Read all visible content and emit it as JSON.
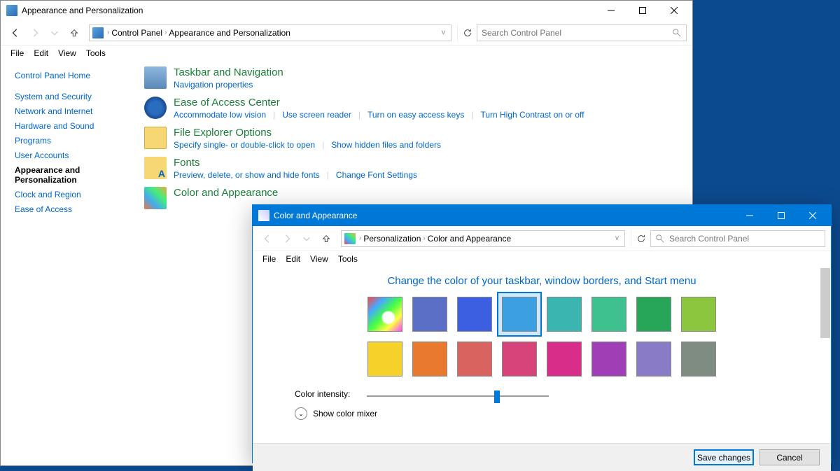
{
  "main_window": {
    "title": "Appearance and Personalization",
    "breadcrumbs": [
      "Control Panel",
      "Appearance and Personalization"
    ],
    "search_placeholder": "Search Control Panel",
    "menus": {
      "file": "File",
      "edit": "Edit",
      "view": "View",
      "tools": "Tools"
    }
  },
  "sidebar": {
    "home": "Control Panel Home",
    "items": [
      "System and Security",
      "Network and Internet",
      "Hardware and Sound",
      "Programs",
      "User Accounts",
      "Appearance and Personalization",
      "Clock and Region",
      "Ease of Access"
    ],
    "active_index": 5
  },
  "categories": [
    {
      "id": "taskbar",
      "title": "Taskbar and Navigation",
      "links": [
        "Navigation properties"
      ]
    },
    {
      "id": "ease",
      "title": "Ease of Access Center",
      "links": [
        "Accommodate low vision",
        "Use screen reader",
        "Turn on easy access keys",
        "Turn High Contrast on or off"
      ]
    },
    {
      "id": "explorer",
      "title": "File Explorer Options",
      "links": [
        "Specify single- or double-click to open",
        "Show hidden files and folders"
      ]
    },
    {
      "id": "fonts",
      "title": "Fonts",
      "links": [
        "Preview, delete, or show and hide fonts",
        "Change Font Settings"
      ]
    },
    {
      "id": "color",
      "title": "Color and Appearance",
      "links": []
    }
  ],
  "dialog": {
    "title": "Color and Appearance",
    "breadcrumbs": [
      "Personalization",
      "Color and Appearance"
    ],
    "search_placeholder": "Search Control Panel",
    "menus": {
      "file": "File",
      "edit": "Edit",
      "view": "View",
      "tools": "Tools"
    },
    "heading": "Change the color of your taskbar, window borders, and Start menu",
    "colors": [
      {
        "hex": "auto",
        "name": "Automatic"
      },
      {
        "hex": "#5b6fc7",
        "name": "Indigo"
      },
      {
        "hex": "#3b5fe0",
        "name": "Blue"
      },
      {
        "hex": "#3ca0e0",
        "name": "Sky"
      },
      {
        "hex": "#3bb5b0",
        "name": "Teal"
      },
      {
        "hex": "#3ec18f",
        "name": "Mint"
      },
      {
        "hex": "#27a65a",
        "name": "Green"
      },
      {
        "hex": "#8cc63f",
        "name": "Lime"
      },
      {
        "hex": "#f5d22a",
        "name": "Yellow"
      },
      {
        "hex": "#e8792e",
        "name": "Orange"
      },
      {
        "hex": "#d9645f",
        "name": "Coral"
      },
      {
        "hex": "#d6447a",
        "name": "Rose"
      },
      {
        "hex": "#d82e8a",
        "name": "Magenta"
      },
      {
        "hex": "#a03fb5",
        "name": "Purple"
      },
      {
        "hex": "#8a7bc7",
        "name": "Lavender"
      },
      {
        "hex": "#7e8c82",
        "name": "Taupe"
      }
    ],
    "selected_index": 3,
    "intensity_label": "Color intensity:",
    "intensity_value": 70,
    "mixer_label": "Show color mixer",
    "buttons": {
      "save": "Save changes",
      "cancel": "Cancel"
    }
  }
}
